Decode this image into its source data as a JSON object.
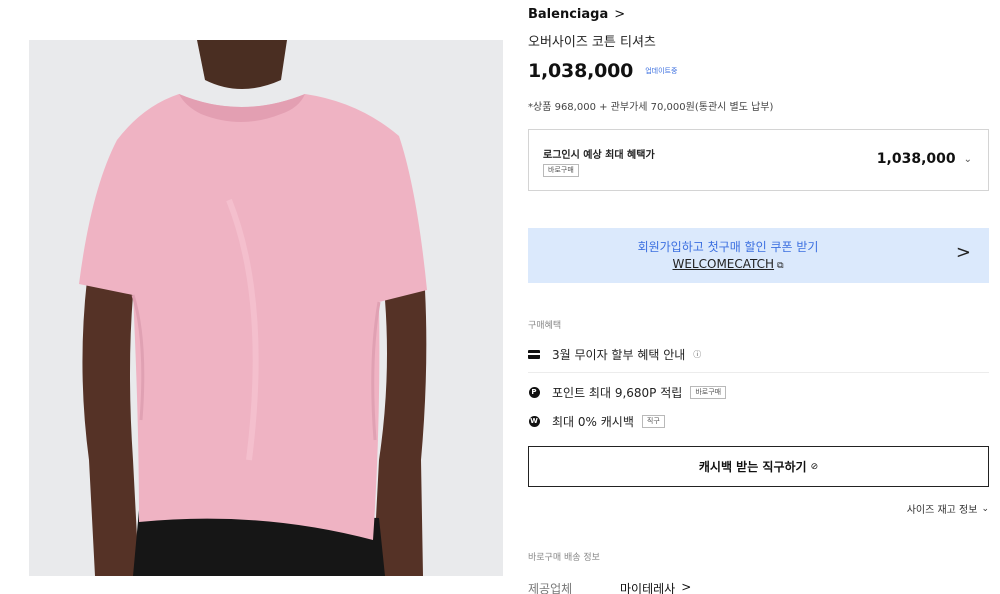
{
  "product": {
    "brand": "Balenciaga",
    "brand_chevron": ">",
    "title": "오버사이즈 코튼 티셔츠",
    "price": "1,038,000",
    "price_status": "업데이트중",
    "price_breakdown": "*상품 968,000 + 관부가세 70,000원(통관시 별도 납부)",
    "image_alt": "pink oversized cotton t-shirt on model"
  },
  "benefit_box": {
    "label": "로그인시 예상 최대 혜택가",
    "tag": "바로구매",
    "price": "1,038,000",
    "chevron": "⌄"
  },
  "coupon": {
    "title": "회원가입하고 첫구매 할인 쿠폰 받기",
    "code": "WELCOMECATCH",
    "copy_icon": "⧉",
    "arrow": ">"
  },
  "purchase_benefits": {
    "section_label": "구매혜택",
    "installment": "3월 무이자 할부 혜택 안내",
    "installment_info_icon": "ⓘ",
    "point": "포인트 최대 9,680P 적립",
    "point_tag": "바로구매",
    "point_icon_text": "P",
    "cashback": "최대 0% 캐시백",
    "cashback_tag": "직구",
    "cashback_icon_text": "W"
  },
  "buy_button": {
    "label": "캐시백 받는 직구하기",
    "icon": "⊘"
  },
  "size_link": {
    "label": "사이즈 재고 정보",
    "chevron": "⌄"
  },
  "shipping": {
    "section_label": "바로구매 배송 정보",
    "supplier_key": "제공업체",
    "supplier_value": "마이테레사",
    "supplier_chevron": ">"
  },
  "colors": {
    "shirt": "#efb3c3",
    "image_bg": "#e9eaec",
    "coupon_bg": "#dbe9fc",
    "accent_blue": "#3b6fe0"
  }
}
